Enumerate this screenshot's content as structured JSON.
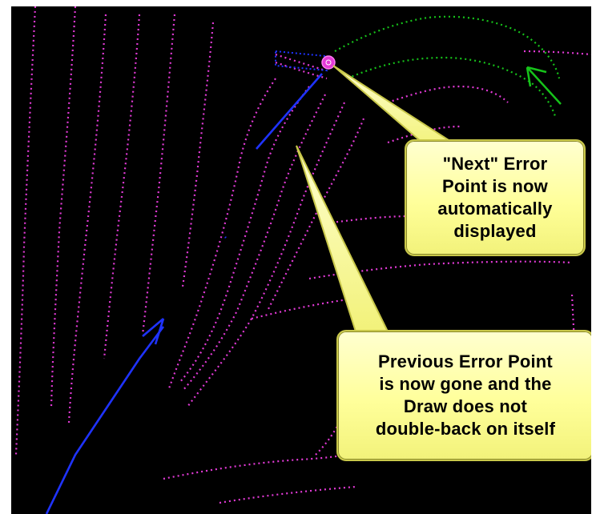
{
  "colors": {
    "background": "#000000",
    "contour": "#e23ad6",
    "draw_line": "#1f33ff",
    "green_contour": "#16c21a",
    "error_marker": "#e23ad6",
    "callout_fill": "#ffff9a"
  },
  "callouts": {
    "next_error": "\"Next\" Error\nPoint is now\nautomatically\ndisplayed",
    "previous_error": "Previous Error Point\nis now gone and the\nDraw does not\ndouble-back on itself"
  }
}
